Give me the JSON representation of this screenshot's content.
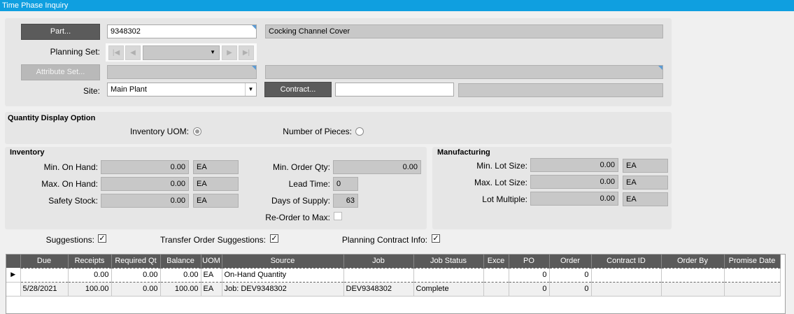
{
  "window": {
    "title": "Time Phase Inquiry"
  },
  "part": {
    "button_label": "Part...",
    "number": "9348302",
    "description": "Cocking Channel Cover"
  },
  "planning_set": {
    "label": "Planning Set:",
    "value": "",
    "nav_first": "|◀",
    "nav_prev": "◀",
    "nav_next": "▶",
    "nav_last": "▶|"
  },
  "attribute_set": {
    "button_label": "Attribute Set...",
    "value": "",
    "description": ""
  },
  "site": {
    "label": "Site:",
    "value": "Main Plant"
  },
  "contract": {
    "button_label": "Contract...",
    "value": "",
    "description": ""
  },
  "quantity_display": {
    "header": "Quantity Display Option",
    "inventory_uom_label": "Inventory UOM:",
    "pieces_label": "Number of Pieces:",
    "selected": "Inventory UOM"
  },
  "inventory": {
    "header": "Inventory",
    "min_on_hand": {
      "label": "Min. On Hand:",
      "value": "0.00",
      "uom": "EA"
    },
    "max_on_hand": {
      "label": "Max. On Hand:",
      "value": "0.00",
      "uom": "EA"
    },
    "safety_stock": {
      "label": "Safety Stock:",
      "value": "0.00",
      "uom": "EA"
    },
    "min_order_qty": {
      "label": "Min. Order Qty:",
      "value": "0.00"
    },
    "lead_time": {
      "label": "Lead Time:",
      "value": "0"
    },
    "days_of_supply": {
      "label": "Days of Supply:",
      "value": "63"
    },
    "reorder_to_max": {
      "label": "Re-Order to Max:",
      "checked": false
    }
  },
  "manufacturing": {
    "header": "Manufacturing",
    "min_lot_size": {
      "label": "Min. Lot Size:",
      "value": "0.00",
      "uom": "EA"
    },
    "max_lot_size": {
      "label": "Max. Lot Size:",
      "value": "0.00",
      "uom": "EA"
    },
    "lot_multiple": {
      "label": "Lot Multiple:",
      "value": "0.00",
      "uom": "EA"
    }
  },
  "options": {
    "suggestions": {
      "label": "Suggestions:",
      "checked": true,
      "mark": "✓"
    },
    "transfer_suggestions": {
      "label": "Transfer Order Suggestions:",
      "checked": true,
      "mark": "✓"
    },
    "planning_contract": {
      "label": "Planning Contract Info:",
      "checked": true,
      "mark": "✓"
    }
  },
  "grid": {
    "row_indicator": "▶",
    "columns": [
      "Due",
      "Receipts",
      "Required Qt",
      "Balance",
      "UOM",
      "Source",
      "Job",
      "Job Status",
      "Exce",
      "PO",
      "Order",
      "Contract ID",
      "Order By",
      "Promise Date"
    ],
    "rows": [
      [
        "",
        "0.00",
        "0.00",
        "0.00",
        "EA",
        "On-Hand Quantity",
        "",
        "",
        "",
        "0",
        "0",
        "",
        "",
        ""
      ],
      [
        "5/28/2021",
        "100.00",
        "0.00",
        "100.00",
        "EA",
        "Job: DEV9348302",
        "DEV9348302",
        "Complete",
        "",
        "0",
        "0",
        "",
        "",
        ""
      ]
    ]
  }
}
